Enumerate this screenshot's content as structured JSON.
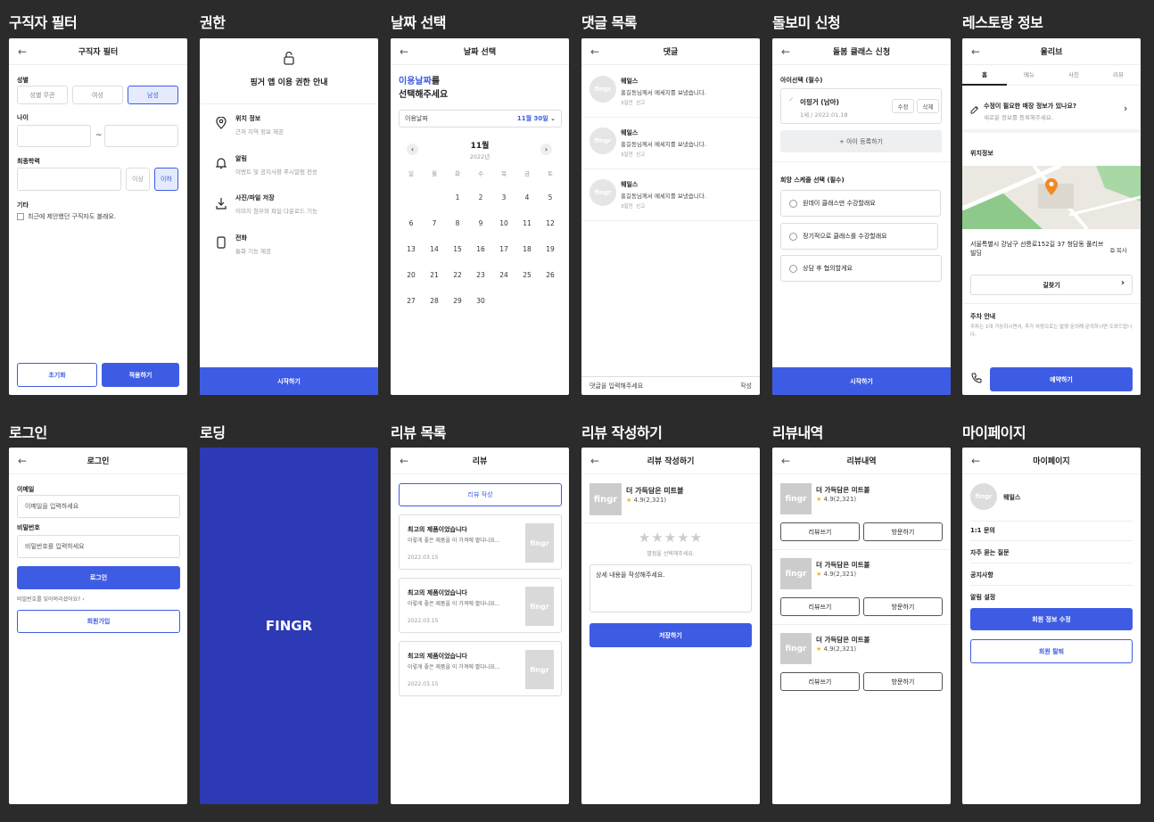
{
  "labels": [
    "구직자 필터",
    "권한",
    "날짜 선택",
    "댓글 목록",
    "돌보미 신청",
    "레스토랑 정보",
    "로그인",
    "로딩",
    "리뷰 목록",
    "리뷰 작성하기",
    "리뷰내역",
    "마이페이지"
  ],
  "back": "←",
  "filter": {
    "title": "구직자 필터",
    "gender": "성별",
    "g1": "성별 무관",
    "g2": "여성",
    "g3": "남성",
    "age": "나이",
    "tilde": "~",
    "edu": "최종학력",
    "more": "이상",
    "less": "이하",
    "etc": "기타",
    "etc_opt": "최근에 제안했던 구직자도 볼래요.",
    "reset": "초기화",
    "apply": "적용하기"
  },
  "perm": {
    "title": "핑거 앱 이용 권한 안내",
    "items": [
      {
        "t": "위치 정보",
        "d": "근처 지역 정보 제공"
      },
      {
        "t": "알림",
        "d": "이벤트 및 공지사항 푸시알림 전송"
      },
      {
        "t": "사진/파일 저장",
        "d": "이미지 첨부와 파일 다운로드 기능"
      },
      {
        "t": "전화",
        "d": "통화 기능 제공"
      }
    ],
    "start": "시작하기"
  },
  "date": {
    "title": "날짜 선택",
    "h1a": "이용날짜",
    "h1b": "를",
    "h2": "선택해주세요",
    "row_label": "이용날짜",
    "selected": "11월 30일",
    "month": "11월",
    "year": "2022년",
    "wd": [
      "일",
      "월",
      "화",
      "수",
      "목",
      "금",
      "토"
    ],
    "weeks": [
      [
        "",
        "",
        "1",
        "2",
        "3",
        "4",
        "5"
      ],
      [
        "6",
        "7",
        "8",
        "9",
        "10",
        "11",
        "12"
      ],
      [
        "13",
        "14",
        "15",
        "16",
        "17",
        "18",
        "19"
      ],
      [
        "20",
        "21",
        "22",
        "23",
        "24",
        "25",
        "26"
      ],
      [
        "27",
        "28",
        "29",
        "30",
        "",
        "",
        ""
      ]
    ]
  },
  "comments": {
    "title": "댓글",
    "avatar": "fingr",
    "items": [
      {
        "name": "웨일스",
        "text": "홍길동님께서 메세지를 보냈습니다.",
        "time": "3일전",
        "report": "신고"
      },
      {
        "name": "웨일스",
        "text": "홍길동님께서 메세지를 보냈습니다.",
        "time": "3일전",
        "report": "신고"
      },
      {
        "name": "웨일스",
        "text": "홍길동님께서 메세지를 보냈습니다.",
        "time": "3일전",
        "report": "신고"
      }
    ],
    "input": "댓글을 입력해주세요",
    "send": "작성"
  },
  "care": {
    "title": "돌봄 클래스 신청",
    "child": "아이선택 (필수)",
    "child_name": "이핑거 (남아)",
    "child_info": "1세 / 2022.01.18",
    "edit": "수정",
    "del": "삭제",
    "add": "+ 아이 등록하기",
    "sched": "희망 스케줄 선택 (필수)",
    "opts": [
      "원데이 클래스만 수강할래요",
      "정기적으로 클래스를 수강할래요",
      "상담 후 협의할게요"
    ],
    "start": "시작하기"
  },
  "rest": {
    "title": "울리브",
    "tabs": [
      "홈",
      "메뉴",
      "사진",
      "리뷰"
    ],
    "banner": "수정이 필요한 매장 정보가 있나요?",
    "banner_sub": "새로운 정보를 등록해주세요.",
    "loc": "위치정보",
    "addr": "서울특별시 강남구 선릉로152길 37 청담동 풀리브빌딩",
    "copy": "복사",
    "route": "길찾기",
    "park": "주차 안내",
    "park_text": "주차는 1대 가능하시면서, 추가 차량으로는 발렛 문의해 문의하시면 도와드립니다.",
    "reserve": "예약하기"
  },
  "login": {
    "title": "로그인",
    "email": "이메일",
    "email_ph": "이메일을 입력하세요",
    "pw": "비밀번호",
    "pw_ph": "비밀번호를 입력하세요",
    "login": "로그인",
    "forgot": "비밀번호를 잊어버리셨어요?",
    "signup": "회원가입"
  },
  "loading": {
    "logo": "FINGR"
  },
  "reviews": {
    "title": "리뷰",
    "write": "리뷰 작성",
    "thumb": "fingr",
    "items": [
      {
        "t": "최고의 제품이었습니다",
        "d": "이렇게 좋은 제품을 이 가격에 팔다니요...",
        "date": "2022.03.15"
      },
      {
        "t": "최고의 제품이었습니다",
        "d": "이렇게 좋은 제품을 이 가격에 팔다니요...",
        "date": "2022.03.15"
      },
      {
        "t": "최고의 제품이었습니다",
        "d": "이렇게 좋은 제품을 이 가격에 팔다니요...",
        "date": "2022.03.15"
      }
    ]
  },
  "write": {
    "title": "리뷰 작성하기",
    "thumb": "fingr",
    "name": "더 가득담은 미트볼",
    "rating": "4.9(2,321)",
    "hint": "별점을 선택해주세요.",
    "placeholder": "상세 내용을 작성해주세요.",
    "save": "저장하기"
  },
  "history": {
    "title": "리뷰내역",
    "thumb": "fingr",
    "items": [
      {
        "name": "더 가득담은 미트볼",
        "rating": "4.9(2,321)"
      },
      {
        "name": "더 가득담은 미트볼",
        "rating": "4.9(2,321)"
      },
      {
        "name": "더 가득담은 미트볼",
        "rating": "4.9(2,321)"
      }
    ],
    "b1": "리뷰쓰기",
    "b2": "방문하기"
  },
  "my": {
    "title": "마이페이지",
    "avatar": "fingr",
    "name": "웨일스",
    "menu": [
      "1:1 문의",
      "자주 묻는 질문",
      "공지사항",
      "알림 설정"
    ],
    "edit": "회원 정보 수정",
    "leave": "회원 탈퇴"
  },
  "colors": {
    "primary": "#3e5ce3",
    "loading_bg": "#2c3ab5",
    "star": "#f2b51d",
    "pin": "#f08a24"
  }
}
